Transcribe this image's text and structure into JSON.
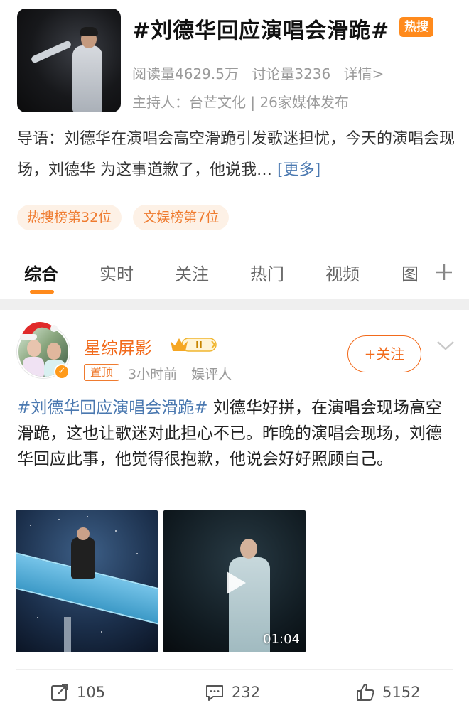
{
  "topic": {
    "title": "#刘德华回应演唱会滑跪#",
    "hot_badge": "热搜",
    "stats": {
      "reads": "阅读量4629.5万",
      "discussions": "讨论量3236",
      "details": "详情>"
    },
    "host": "主持人：台芒文化 | 26家媒体发布",
    "intro": "导语：刘德华在演唱会高空滑跪引发歌迷担忧，今天的演唱会现场，刘德华 为这事道歉了，他说我…",
    "more_label": "[更多]",
    "tags": [
      "热搜榜第32位",
      "文娱榜第7位"
    ]
  },
  "tabs": [
    "综合",
    "实时",
    "关注",
    "热门",
    "视频",
    "图"
  ],
  "post": {
    "username": "星综屏影",
    "pin_label": "置顶",
    "time": "3小时前",
    "category": "娱评人",
    "follow_label": "+关注",
    "topic_link": "#刘德华回应演唱会滑跪#",
    "text": " 刘德华好拼，在演唱会现场高空滑跪，这也让歌迷对此担心不已。昨晚的演唱会现场，刘德华回应此事，他觉得很抱歉，他说会好好照顾自己。",
    "video_duration": "01:04",
    "actions": {
      "repost": "105",
      "comments": "232",
      "likes": "5152"
    }
  },
  "colors": {
    "accent_orange": "#ff8a1c",
    "username_orange": "#f26a1b",
    "link_blue": "#4a78b0"
  },
  "icons": [
    "plus-icon",
    "chevron-down-icon",
    "repost-icon",
    "comment-icon",
    "like-icon",
    "play-icon",
    "santa-hat-icon",
    "verified-icon",
    "level-badge-icon"
  ]
}
